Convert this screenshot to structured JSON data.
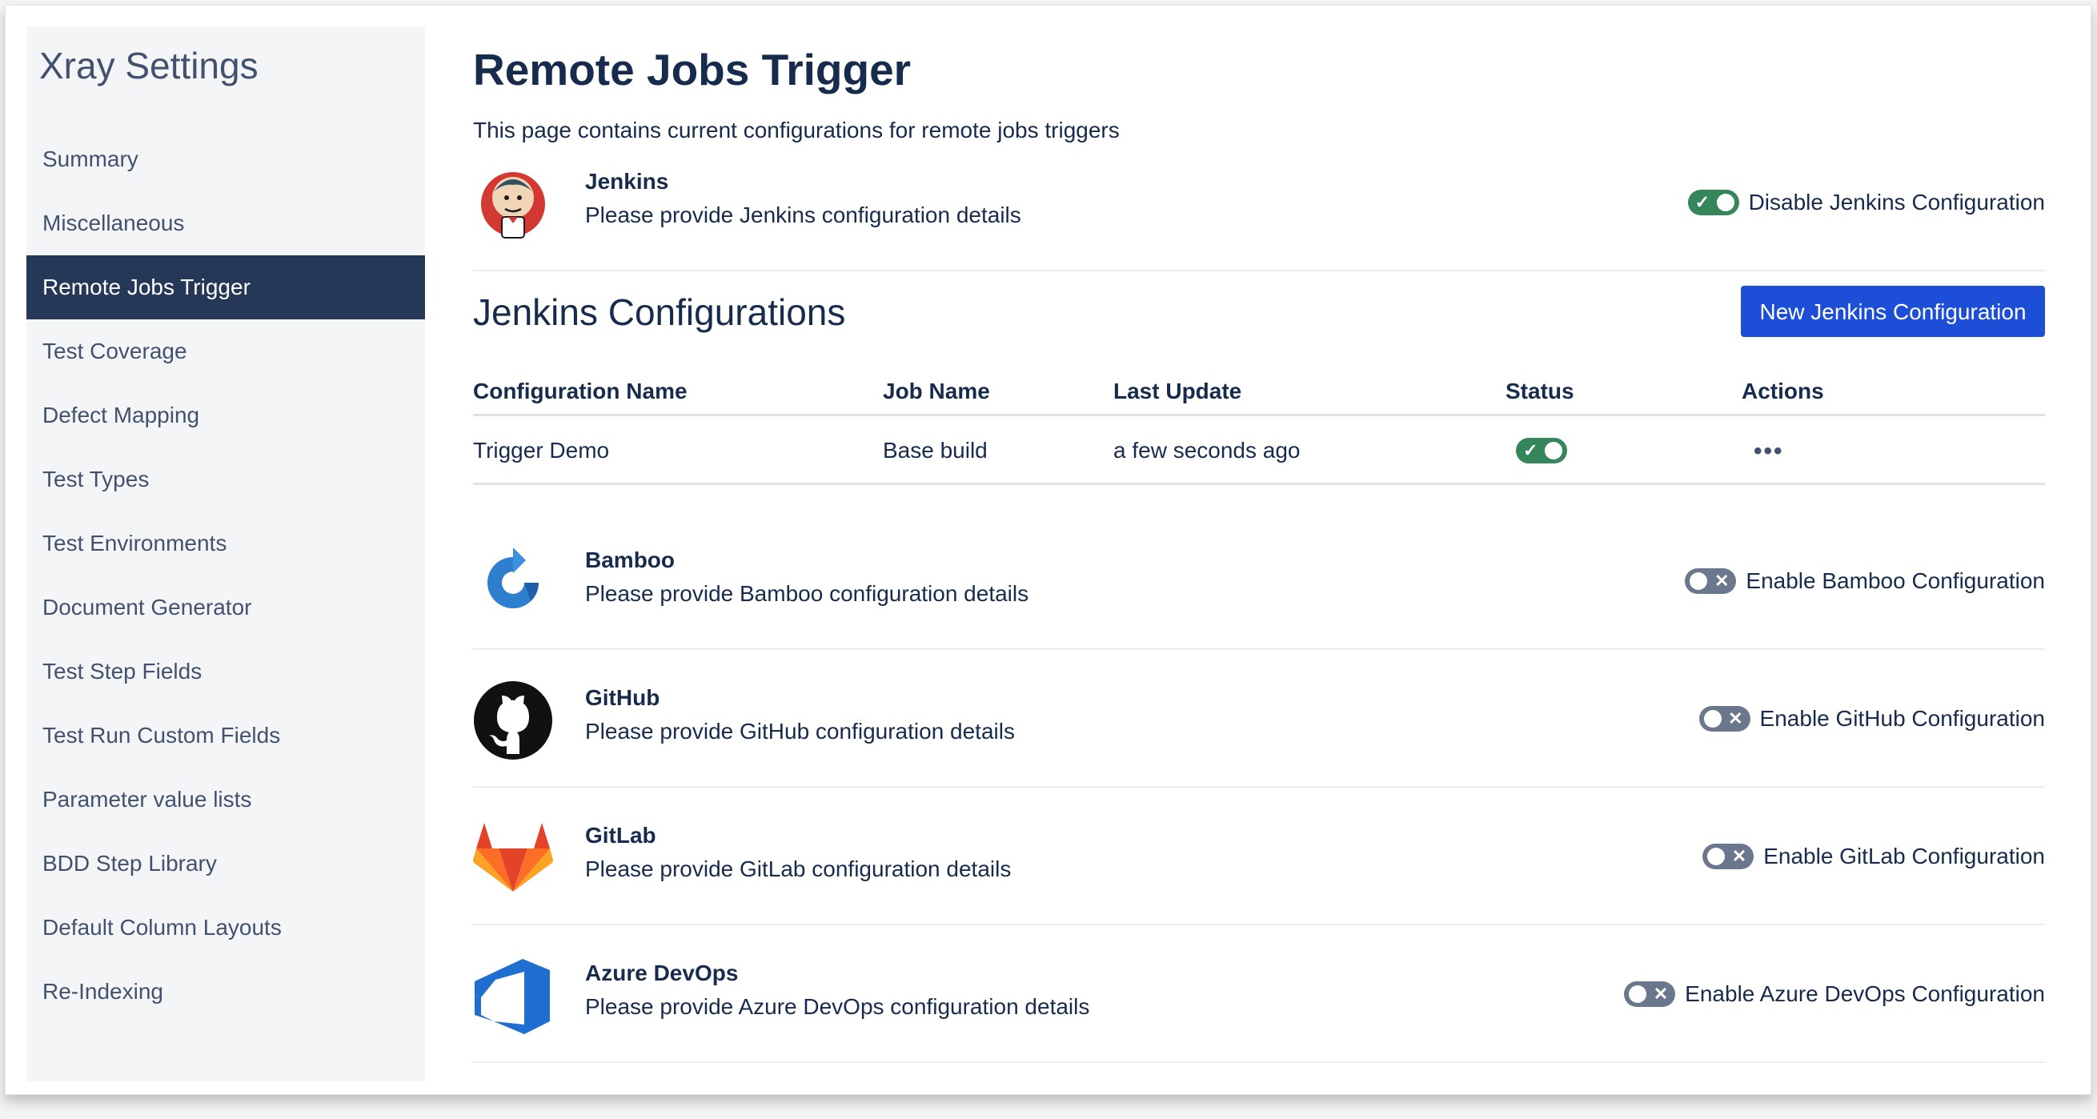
{
  "sidebar": {
    "title": "Xray Settings",
    "items": [
      {
        "label": "Summary"
      },
      {
        "label": "Miscellaneous"
      },
      {
        "label": "Remote Jobs Trigger",
        "active": true
      },
      {
        "label": "Test Coverage"
      },
      {
        "label": "Defect Mapping"
      },
      {
        "label": "Test Types"
      },
      {
        "label": "Test Environments"
      },
      {
        "label": "Document Generator"
      },
      {
        "label": "Test Step Fields"
      },
      {
        "label": "Test Run Custom Fields"
      },
      {
        "label": "Parameter value lists"
      },
      {
        "label": "BDD Step Library"
      },
      {
        "label": "Default Column Layouts"
      },
      {
        "label": "Re-Indexing"
      }
    ]
  },
  "page": {
    "title": "Remote Jobs Trigger",
    "description": "This page contains current configurations for remote jobs triggers"
  },
  "providers": {
    "jenkins": {
      "name": "Jenkins",
      "description": "Please provide Jenkins configuration details",
      "toggle_label": "Disable Jenkins Configuration",
      "enabled": true,
      "icon": "jenkins-logo-icon"
    },
    "bamboo": {
      "name": "Bamboo",
      "description": "Please provide Bamboo configuration details",
      "toggle_label": "Enable Bamboo Configuration",
      "enabled": false,
      "icon": "bamboo-logo-icon"
    },
    "github": {
      "name": "GitHub",
      "description": "Please provide GitHub configuration details",
      "toggle_label": "Enable GitHub Configuration",
      "enabled": false,
      "icon": "github-logo-icon"
    },
    "gitlab": {
      "name": "GitLab",
      "description": "Please provide GitLab configuration details",
      "toggle_label": "Enable GitLab Configuration",
      "enabled": false,
      "icon": "gitlab-logo-icon"
    },
    "azure": {
      "name": "Azure DevOps",
      "description": "Please provide Azure DevOps configuration details",
      "toggle_label": "Enable Azure DevOps Configuration",
      "enabled": false,
      "icon": "azure-devops-logo-icon"
    }
  },
  "jenkins_configs": {
    "title": "Jenkins Configurations",
    "new_button": "New Jenkins Configuration",
    "columns": [
      "Configuration Name",
      "Job Name",
      "Last Update",
      "Status",
      "Actions"
    ],
    "rows": [
      {
        "config_name": "Trigger Demo",
        "job_name": "Base build",
        "last_update": "a few seconds ago",
        "status_enabled": true,
        "actions": "•••"
      }
    ]
  },
  "colors": {
    "active_nav": "#253858",
    "primary_button": "#1d4ed8",
    "toggle_on": "#36865b",
    "toggle_off": "#6b778c"
  }
}
